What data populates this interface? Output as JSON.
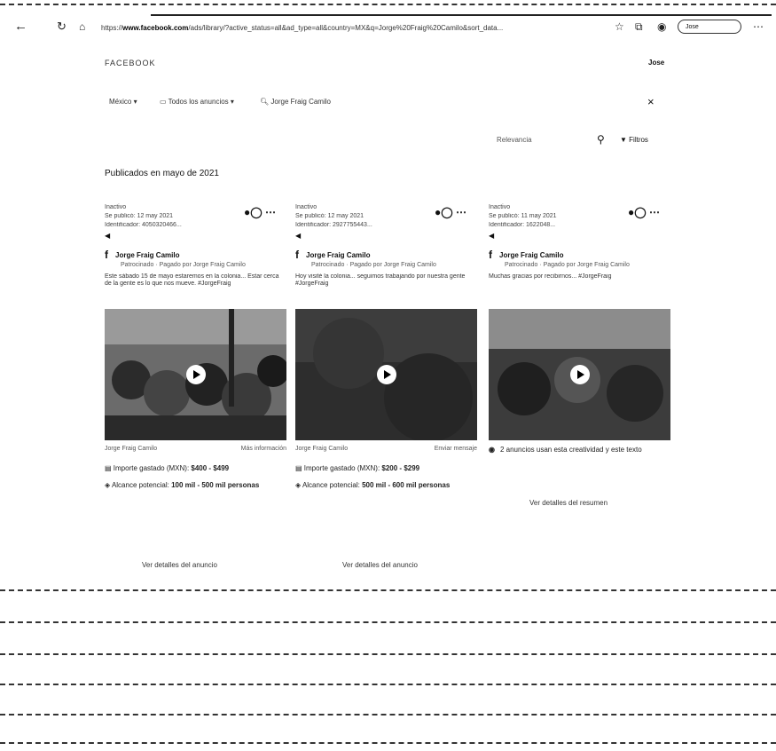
{
  "browser": {
    "url_prefix": "https://",
    "url_domain": "www.facebook.com",
    "url_rest": "/ads/library/?active_status=all&ad_type=all&country=MX&q=Jorge%20Fraig%20Camilo&sort_data...",
    "profile_label": "Jose"
  },
  "header": {
    "brand": "FACEBOOK",
    "user": "Jose"
  },
  "filters": {
    "country": "México",
    "category": "Todos los anuncios",
    "query": "Jorge Fraig Camilo",
    "sort": "Relevancia",
    "filters_label": "Filtros"
  },
  "section_title": "Publicados en mayo de 2021",
  "cards": [
    {
      "status": "Inactivo",
      "date": "Se publicó: 12 may 2021",
      "id": "Identificador: 4050320466...",
      "advertiser": "Jorge Fraig Camilo",
      "advertiser_sub": "Patrocinado · Pagado por Jorge Fraig Camilo",
      "body": "Este sábado 15 de mayo estaremos en la colonia... Estar cerca de la gente es lo que nos mueve. #JorgeFraig",
      "caption_left": "Jorge Fraig Camilo",
      "caption_right": "Más información",
      "spend_label": "Importe gastado (MXN):",
      "spend_value": "$400 - $499",
      "reach_label": "Alcance potencial:",
      "reach_value": "100 mil - 500 mil personas",
      "details": "Ver detalles del anuncio"
    },
    {
      "status": "Inactivo",
      "date": "Se publicó: 12 may 2021",
      "id": "Identificador: 2927755443...",
      "advertiser": "Jorge Fraig Camilo",
      "advertiser_sub": "Patrocinado · Pagado por Jorge Fraig Camilo",
      "body": "Hoy visité la colonia... seguimos trabajando por nuestra gente #JorgeFraig",
      "caption_left": "Jorge Fraig Camilo",
      "caption_right": "Enviar mensaje",
      "spend_label": "Importe gastado (MXN):",
      "spend_value": "$200 - $299",
      "reach_label": "Alcance potencial:",
      "reach_value": "500 mil - 600 mil personas",
      "details": "Ver detalles del anuncio"
    },
    {
      "status": "Inactivo",
      "date": "Se publicó: 11 may 2021",
      "id": "Identificador: 1622048...",
      "advertiser": "Jorge Fraig Camilo",
      "advertiser_sub": "Patrocinado · Pagado por Jorge Fraig Camilo",
      "body": "Muchas gracias por recibirnos... #JorgeFraig",
      "summary": "2 anuncios usan esta creatividad y este texto",
      "details": "Ver detalles del resumen"
    }
  ],
  "colors": {
    "background": "#ffffff",
    "text": "#111111",
    "dash": "#333333"
  }
}
